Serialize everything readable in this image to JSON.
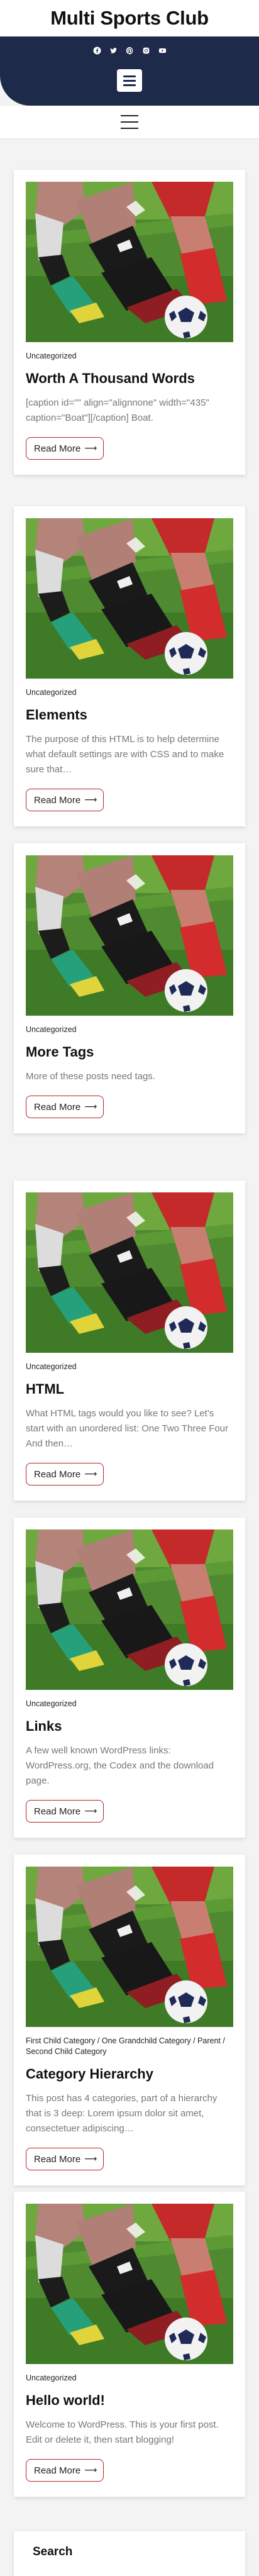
{
  "site": {
    "title": "Multi Sports Club"
  },
  "social": [
    "facebook-icon",
    "twitter-icon",
    "pinterest-icon",
    "instagram-icon",
    "youtube-icon"
  ],
  "colors": {
    "topbar": "#1e2a4a",
    "accent": "#b0262a",
    "excerpt": "#777777"
  },
  "posts": [
    {
      "categories": [
        "Uncategorized"
      ],
      "title": "Worth A Thousand Words",
      "excerpt": "[caption id=\"\" align=\"alignnone\" width=\"435\" caption=\"Boat\"][/caption] Boat.",
      "read_more": "Read More"
    },
    {
      "categories": [
        "Uncategorized"
      ],
      "title": "Elements",
      "excerpt": "The purpose of this HTML is to help determine what default settings are with CSS and to make sure that…",
      "read_more": "Read More"
    },
    {
      "categories": [
        "Uncategorized"
      ],
      "title": "More Tags",
      "excerpt": "More of these posts need tags.",
      "read_more": "Read More"
    },
    {
      "categories": [
        "Uncategorized"
      ],
      "title": "HTML",
      "excerpt": "What HTML tags would you like to see? Let’s start with an unordered list: One Two Three Four And then…",
      "read_more": "Read More"
    },
    {
      "categories": [
        "Uncategorized"
      ],
      "title": "Links",
      "excerpt": "A few well known WordPress links: WordPress.org, the Codex and the download page.",
      "read_more": "Read More"
    },
    {
      "categories": [
        "First Child Category",
        "One Grandchild Category",
        "Parent",
        "Second Child Category"
      ],
      "title": "Category Hierarchy",
      "excerpt": "This post has 4 categories, part of a hierarchy that is 3 deep: Lorem ipsum dolor sit amet, consectetuer adipiscing…",
      "read_more": "Read More"
    },
    {
      "categories": [
        "Uncategorized"
      ],
      "title": "Hello world!",
      "excerpt": "Welcome to WordPress. This is your first post. Edit or delete it, then start blogging!",
      "read_more": "Read More"
    }
  ],
  "sidebar": {
    "search_title": "Search"
  }
}
